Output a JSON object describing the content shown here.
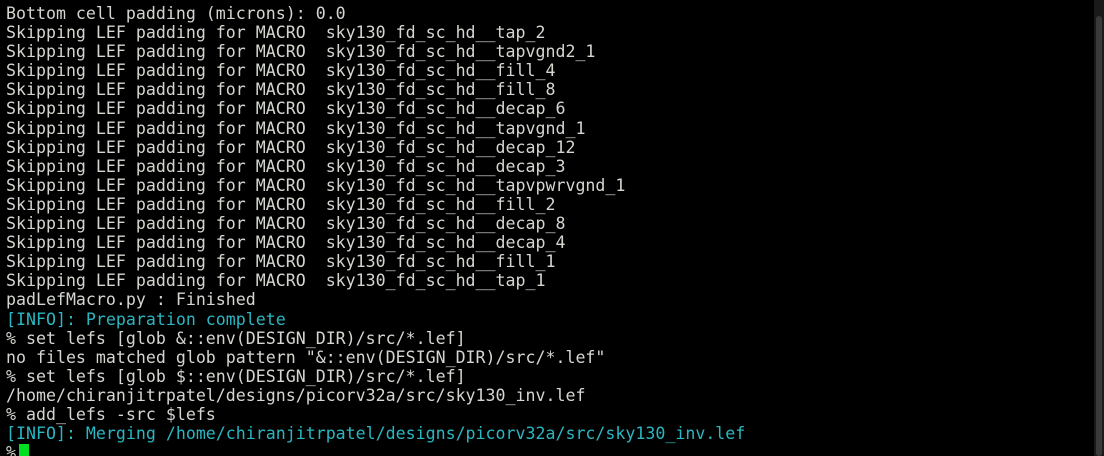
{
  "terminal": {
    "lines": [
      {
        "text": "Bottom cell padding (microns): 0.0",
        "style": "normal"
      },
      {
        "text": "Skipping LEF padding for MACRO  sky130_fd_sc_hd__tap_2",
        "style": "normal"
      },
      {
        "text": "Skipping LEF padding for MACRO  sky130_fd_sc_hd__tapvgnd2_1",
        "style": "normal"
      },
      {
        "text": "Skipping LEF padding for MACRO  sky130_fd_sc_hd__fill_4",
        "style": "normal"
      },
      {
        "text": "Skipping LEF padding for MACRO  sky130_fd_sc_hd__fill_8",
        "style": "normal"
      },
      {
        "text": "Skipping LEF padding for MACRO  sky130_fd_sc_hd__decap_6",
        "style": "normal"
      },
      {
        "text": "Skipping LEF padding for MACRO  sky130_fd_sc_hd__tapvgnd_1",
        "style": "normal"
      },
      {
        "text": "Skipping LEF padding for MACRO  sky130_fd_sc_hd__decap_12",
        "style": "normal"
      },
      {
        "text": "Skipping LEF padding for MACRO  sky130_fd_sc_hd__decap_3",
        "style": "normal"
      },
      {
        "text": "Skipping LEF padding for MACRO  sky130_fd_sc_hd__tapvpwrvgnd_1",
        "style": "normal"
      },
      {
        "text": "Skipping LEF padding for MACRO  sky130_fd_sc_hd__fill_2",
        "style": "normal"
      },
      {
        "text": "Skipping LEF padding for MACRO  sky130_fd_sc_hd__decap_8",
        "style": "normal"
      },
      {
        "text": "Skipping LEF padding for MACRO  sky130_fd_sc_hd__decap_4",
        "style": "normal"
      },
      {
        "text": "Skipping LEF padding for MACRO  sky130_fd_sc_hd__fill_1",
        "style": "normal"
      },
      {
        "text": "Skipping LEF padding for MACRO  sky130_fd_sc_hd__tap_1",
        "style": "normal"
      },
      {
        "text": "padLefMacro.py : Finished",
        "style": "normal"
      },
      {
        "text": "[INFO]: Preparation complete",
        "style": "info"
      },
      {
        "text": "% set lefs [glob &::env(DESIGN_DIR)/src/*.lef]",
        "style": "normal"
      },
      {
        "text": "no files matched glob pattern \"&::env(DESIGN_DIR)/src/*.lef\"",
        "style": "normal"
      },
      {
        "text": "% set lefs [glob $::env(DESIGN_DIR)/src/*.lef]",
        "style": "normal"
      },
      {
        "text": "/home/chiranjitrpatel/designs/picorv32a/src/sky130_inv.lef",
        "style": "normal"
      },
      {
        "text": "% add_lefs -src $lefs",
        "style": "normal"
      },
      {
        "text": "[INFO]: Merging /home/chiranjitrpatel/designs/picorv32a/src/sky130_inv.lef",
        "style": "info"
      }
    ],
    "prompt": "%",
    "colors": {
      "background": "#000000",
      "foreground": "#d3d7cf",
      "info": "#2ab7c2",
      "cursor": "#00e020"
    }
  }
}
